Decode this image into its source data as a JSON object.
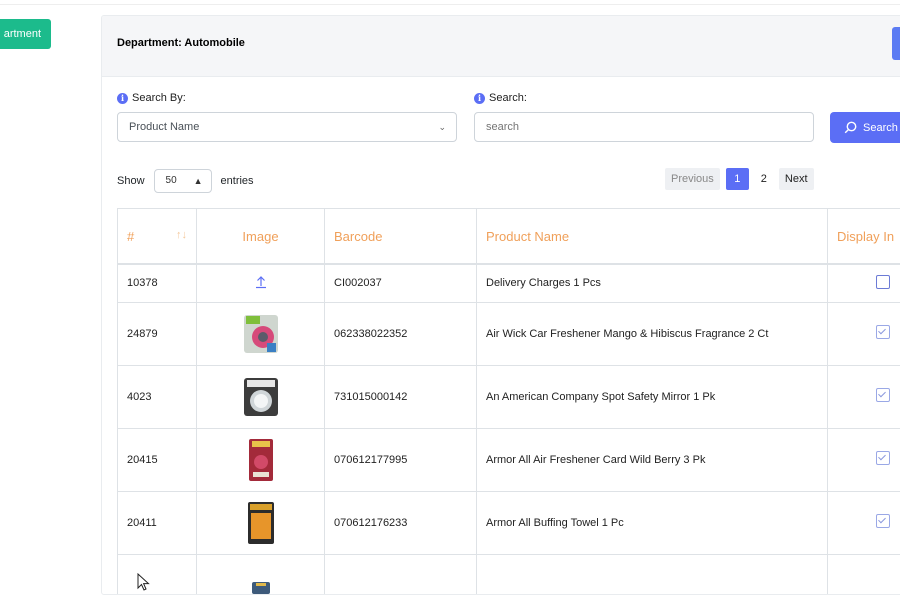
{
  "sidebar": {
    "department_button": "artment"
  },
  "header": {
    "title": "Department: Automobile"
  },
  "search_by": {
    "label": "Search By:",
    "selected": "Product Name"
  },
  "search": {
    "label": "Search:",
    "placeholder": "search",
    "button_label": "Search"
  },
  "length": {
    "show": "Show",
    "value": "50",
    "entries": "entries"
  },
  "pagination": {
    "previous": "Previous",
    "pages": [
      "1",
      "2"
    ],
    "active": "1",
    "next": "Next"
  },
  "table": {
    "columns": [
      "#",
      "Image",
      "Barcode",
      "Product Name",
      "Display In"
    ],
    "rows": [
      {
        "id": "10378",
        "image": "upload-icon",
        "barcode": "CI002037",
        "name": "Delivery Charges 1 Pcs",
        "display": false
      },
      {
        "id": "24879",
        "image": "air-freshener-thumb",
        "barcode": "062338022352",
        "name": "Air Wick Car Freshener Mango & Hibiscus Fragrance 2 Ct",
        "display": true
      },
      {
        "id": "4023",
        "image": "mirror-thumb",
        "barcode": "731015000142",
        "name": "An American Company Spot Safety Mirror 1 Pk",
        "display": true
      },
      {
        "id": "20415",
        "image": "freshener-card-thumb",
        "barcode": "070612177995",
        "name": "Armor All Air Freshener Card Wild Berry 3 Pk",
        "display": true
      },
      {
        "id": "20411",
        "image": "towel-thumb",
        "barcode": "070612176233",
        "name": "Armor All Buffing Towel 1 Pc",
        "display": true
      },
      {
        "id": "",
        "image": "partial-thumb",
        "barcode": "",
        "name": "",
        "display": null
      }
    ]
  },
  "colors": {
    "primary": "#5b6ef5",
    "success": "#1cbb8c",
    "header_text": "#f0a05a"
  }
}
